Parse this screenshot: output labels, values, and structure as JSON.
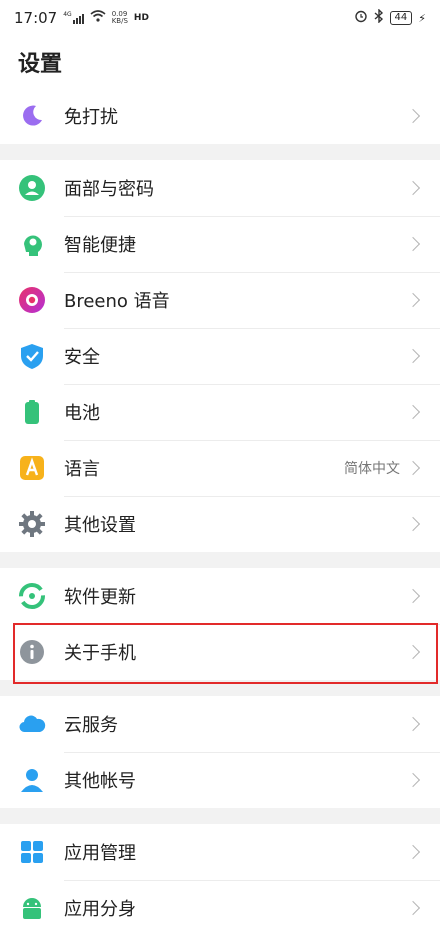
{
  "status": {
    "time": "17:07",
    "signal": "4G",
    "speed_top": "0.09",
    "speed_bottom": "KB/S",
    "hd": "HD",
    "battery": "44"
  },
  "header": {
    "title": "设置"
  },
  "sections": [
    {
      "items": [
        {
          "label": "免打扰",
          "icon": "moon-icon"
        }
      ]
    },
    {
      "items": [
        {
          "label": "面部与密码",
          "icon": "face-password-icon"
        },
        {
          "label": "智能便捷",
          "icon": "smart-assist-icon"
        },
        {
          "label": "Breeno 语音",
          "icon": "breeno-icon"
        },
        {
          "label": "安全",
          "icon": "shield-icon"
        },
        {
          "label": "电池",
          "icon": "battery-icon"
        },
        {
          "label": "语言",
          "icon": "language-icon",
          "value": "简体中文"
        },
        {
          "label": "其他设置",
          "icon": "gear-icon"
        }
      ]
    },
    {
      "items": [
        {
          "label": "软件更新",
          "icon": "software-update-icon"
        },
        {
          "label": "关于手机",
          "icon": "info-icon"
        }
      ]
    },
    {
      "items": [
        {
          "label": "云服务",
          "icon": "cloud-icon"
        },
        {
          "label": "其他帐号",
          "icon": "person-icon"
        }
      ]
    },
    {
      "items": [
        {
          "label": "应用管理",
          "icon": "app-grid-icon"
        },
        {
          "label": "应用分身",
          "icon": "android-icon"
        }
      ]
    }
  ],
  "colors": {
    "highlight": "#e22a2a",
    "accent_green": "#35c27a",
    "accent_blue": "#2aa0f0"
  }
}
